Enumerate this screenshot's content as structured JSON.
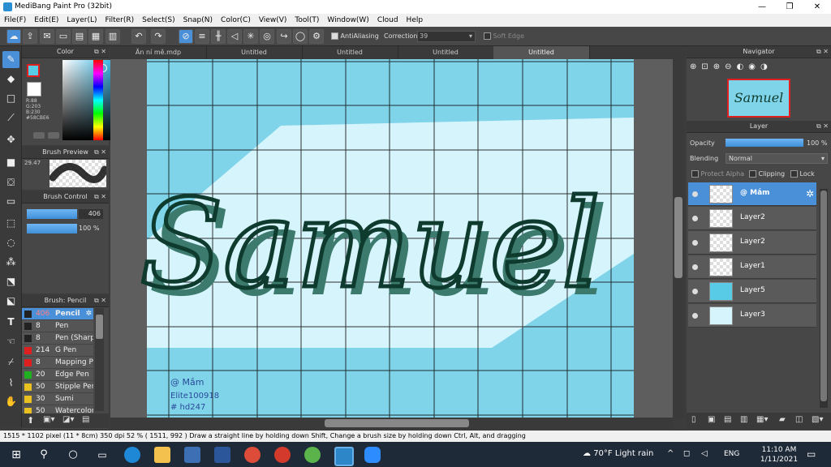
{
  "window": {
    "title": "MediBang Paint Pro (32bit)",
    "minimize": "—",
    "maximize": "❐",
    "close": "✕"
  },
  "menu": [
    "File(F)",
    "Edit(E)",
    "Layer(L)",
    "Filter(R)",
    "Select(S)",
    "Snap(N)",
    "Color(C)",
    "View(V)",
    "Tool(T)",
    "Window(W)",
    "Cloud",
    "Help"
  ],
  "toolbar": {
    "antialiasing": "AntiAliasing",
    "correction_label": "Correction",
    "correction_value": "39",
    "soft_edge": "Soft Edge"
  },
  "color_panel": {
    "title": "Color",
    "r": "R:88",
    "g": "G:203",
    "b": "B:230",
    "hex": "#58CBE6",
    "primary": "#58cbe6",
    "secondary": "#ffffff"
  },
  "brush_preview": {
    "title": "Brush Preview",
    "size": "29.47"
  },
  "brush_control": {
    "title": "Brush Control",
    "size": "406",
    "opacity": "100 %"
  },
  "brush_list": {
    "title": "Brush: Pencil",
    "items": [
      {
        "color": "#222222",
        "size": "406",
        "name": "Pencil",
        "active": true
      },
      {
        "color": "#222222",
        "size": "8",
        "name": "Pen"
      },
      {
        "color": "#222222",
        "size": "8",
        "name": "Pen (Sharp)"
      },
      {
        "color": "#e02020",
        "size": "214",
        "name": "G Pen"
      },
      {
        "color": "#e02020",
        "size": "8",
        "name": "Mapping Pen"
      },
      {
        "color": "#20b020",
        "size": "20",
        "name": "Edge Pen"
      },
      {
        "color": "#e8c020",
        "size": "50",
        "name": "Stipple Pen"
      },
      {
        "color": "#e8c020",
        "size": "30",
        "name": "Sumi"
      },
      {
        "color": "#e8c020",
        "size": "50",
        "name": "Watercolor"
      }
    ]
  },
  "tabs": [
    {
      "label": "Ăn ní mê.mdp",
      "active": false
    },
    {
      "label": "Untitled",
      "active": false
    },
    {
      "label": "Untitled",
      "active": false
    },
    {
      "label": "Untitled",
      "active": false
    },
    {
      "label": "Untitled",
      "active": true
    }
  ],
  "canvas": {
    "lettering": "Samuel",
    "note1": "@ Mắm",
    "note2": "Elite100918",
    "note3": "# hd247"
  },
  "navigator": {
    "title": "Navigator"
  },
  "layer_panel": {
    "title": "Layer",
    "opacity_label": "Opacity",
    "opacity_value": "100 %",
    "blending_label": "Blending",
    "blending_value": "Normal",
    "protect_alpha": "Protect Alpha",
    "clipping": "Clipping",
    "lock": "Lock",
    "layers": [
      {
        "name": "@ Mắm",
        "active": true
      },
      {
        "name": "Layer2",
        "active": false
      },
      {
        "name": "Layer2",
        "active": false
      },
      {
        "name": "Layer1",
        "active": false
      },
      {
        "name": "Layer5",
        "active": false
      },
      {
        "name": "Layer3",
        "active": false
      }
    ]
  },
  "status": "1515 * 1102 pixel   (11 * 8cm)   350 dpi   52 %   ( 1511, 992 )   Draw a straight line by holding down Shift, Change a brush size by holding down Ctrl, Alt, and dragging",
  "taskbar": {
    "weather": "70°F  Light rain",
    "lang": "ENG",
    "time": "11:10 AM",
    "date": "1/11/2021"
  }
}
